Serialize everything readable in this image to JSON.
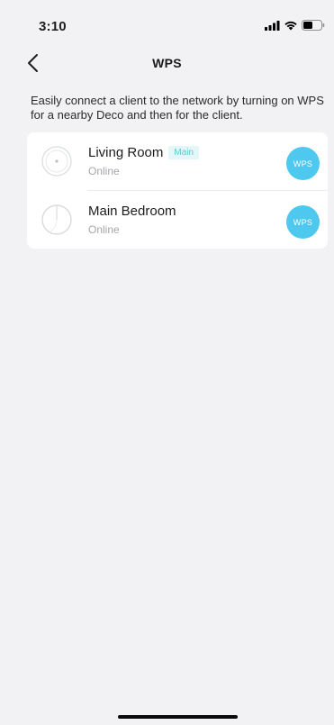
{
  "status_bar": {
    "time": "3:10",
    "icons": [
      "cellular-signal-icon",
      "wifi-icon",
      "battery-icon"
    ]
  },
  "nav": {
    "back_icon": "chevron-left-icon",
    "title": "WPS"
  },
  "description": "Easily connect a client to the network by turning on WPS for a nearby Deco and then for the client.",
  "devices": [
    {
      "name": "Living Room",
      "badge": "Main",
      "status": "Online",
      "wps_label": "WPS",
      "icon": "deco-round-device-icon"
    },
    {
      "name": "Main Bedroom",
      "badge": "",
      "status": "Online",
      "wps_label": "WPS",
      "icon": "deco-device-icon"
    }
  ],
  "colors": {
    "background": "#f2f2f5",
    "card": "#ffffff",
    "wps_button": "#4ec8ee",
    "badge_bg": "#e3f6f8",
    "badge_text": "#5fc9d4",
    "status_text": "#a6a6ab"
  }
}
